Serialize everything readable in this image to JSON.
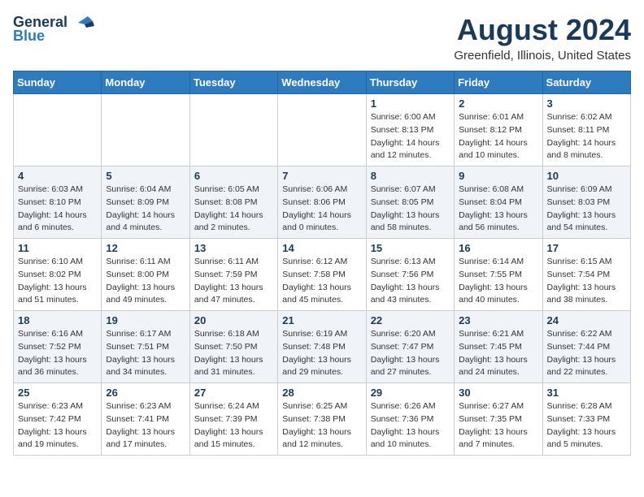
{
  "header": {
    "logo_general": "General",
    "logo_blue": "Blue",
    "title": "August 2024",
    "subtitle": "Greenfield, Illinois, United States"
  },
  "days_of_week": [
    "Sunday",
    "Monday",
    "Tuesday",
    "Wednesday",
    "Thursday",
    "Friday",
    "Saturday"
  ],
  "weeks": [
    [
      {
        "day": "",
        "info": ""
      },
      {
        "day": "",
        "info": ""
      },
      {
        "day": "",
        "info": ""
      },
      {
        "day": "",
        "info": ""
      },
      {
        "day": "1",
        "info": "Sunrise: 6:00 AM\nSunset: 8:13 PM\nDaylight: 14 hours\nand 12 minutes."
      },
      {
        "day": "2",
        "info": "Sunrise: 6:01 AM\nSunset: 8:12 PM\nDaylight: 14 hours\nand 10 minutes."
      },
      {
        "day": "3",
        "info": "Sunrise: 6:02 AM\nSunset: 8:11 PM\nDaylight: 14 hours\nand 8 minutes."
      }
    ],
    [
      {
        "day": "4",
        "info": "Sunrise: 6:03 AM\nSunset: 8:10 PM\nDaylight: 14 hours\nand 6 minutes."
      },
      {
        "day": "5",
        "info": "Sunrise: 6:04 AM\nSunset: 8:09 PM\nDaylight: 14 hours\nand 4 minutes."
      },
      {
        "day": "6",
        "info": "Sunrise: 6:05 AM\nSunset: 8:08 PM\nDaylight: 14 hours\nand 2 minutes."
      },
      {
        "day": "7",
        "info": "Sunrise: 6:06 AM\nSunset: 8:06 PM\nDaylight: 14 hours\nand 0 minutes."
      },
      {
        "day": "8",
        "info": "Sunrise: 6:07 AM\nSunset: 8:05 PM\nDaylight: 13 hours\nand 58 minutes."
      },
      {
        "day": "9",
        "info": "Sunrise: 6:08 AM\nSunset: 8:04 PM\nDaylight: 13 hours\nand 56 minutes."
      },
      {
        "day": "10",
        "info": "Sunrise: 6:09 AM\nSunset: 8:03 PM\nDaylight: 13 hours\nand 54 minutes."
      }
    ],
    [
      {
        "day": "11",
        "info": "Sunrise: 6:10 AM\nSunset: 8:02 PM\nDaylight: 13 hours\nand 51 minutes."
      },
      {
        "day": "12",
        "info": "Sunrise: 6:11 AM\nSunset: 8:00 PM\nDaylight: 13 hours\nand 49 minutes."
      },
      {
        "day": "13",
        "info": "Sunrise: 6:11 AM\nSunset: 7:59 PM\nDaylight: 13 hours\nand 47 minutes."
      },
      {
        "day": "14",
        "info": "Sunrise: 6:12 AM\nSunset: 7:58 PM\nDaylight: 13 hours\nand 45 minutes."
      },
      {
        "day": "15",
        "info": "Sunrise: 6:13 AM\nSunset: 7:56 PM\nDaylight: 13 hours\nand 43 minutes."
      },
      {
        "day": "16",
        "info": "Sunrise: 6:14 AM\nSunset: 7:55 PM\nDaylight: 13 hours\nand 40 minutes."
      },
      {
        "day": "17",
        "info": "Sunrise: 6:15 AM\nSunset: 7:54 PM\nDaylight: 13 hours\nand 38 minutes."
      }
    ],
    [
      {
        "day": "18",
        "info": "Sunrise: 6:16 AM\nSunset: 7:52 PM\nDaylight: 13 hours\nand 36 minutes."
      },
      {
        "day": "19",
        "info": "Sunrise: 6:17 AM\nSunset: 7:51 PM\nDaylight: 13 hours\nand 34 minutes."
      },
      {
        "day": "20",
        "info": "Sunrise: 6:18 AM\nSunset: 7:50 PM\nDaylight: 13 hours\nand 31 minutes."
      },
      {
        "day": "21",
        "info": "Sunrise: 6:19 AM\nSunset: 7:48 PM\nDaylight: 13 hours\nand 29 minutes."
      },
      {
        "day": "22",
        "info": "Sunrise: 6:20 AM\nSunset: 7:47 PM\nDaylight: 13 hours\nand 27 minutes."
      },
      {
        "day": "23",
        "info": "Sunrise: 6:21 AM\nSunset: 7:45 PM\nDaylight: 13 hours\nand 24 minutes."
      },
      {
        "day": "24",
        "info": "Sunrise: 6:22 AM\nSunset: 7:44 PM\nDaylight: 13 hours\nand 22 minutes."
      }
    ],
    [
      {
        "day": "25",
        "info": "Sunrise: 6:23 AM\nSunset: 7:42 PM\nDaylight: 13 hours\nand 19 minutes."
      },
      {
        "day": "26",
        "info": "Sunrise: 6:23 AM\nSunset: 7:41 PM\nDaylight: 13 hours\nand 17 minutes."
      },
      {
        "day": "27",
        "info": "Sunrise: 6:24 AM\nSunset: 7:39 PM\nDaylight: 13 hours\nand 15 minutes."
      },
      {
        "day": "28",
        "info": "Sunrise: 6:25 AM\nSunset: 7:38 PM\nDaylight: 13 hours\nand 12 minutes."
      },
      {
        "day": "29",
        "info": "Sunrise: 6:26 AM\nSunset: 7:36 PM\nDaylight: 13 hours\nand 10 minutes."
      },
      {
        "day": "30",
        "info": "Sunrise: 6:27 AM\nSunset: 7:35 PM\nDaylight: 13 hours\nand 7 minutes."
      },
      {
        "day": "31",
        "info": "Sunrise: 6:28 AM\nSunset: 7:33 PM\nDaylight: 13 hours\nand 5 minutes."
      }
    ]
  ]
}
